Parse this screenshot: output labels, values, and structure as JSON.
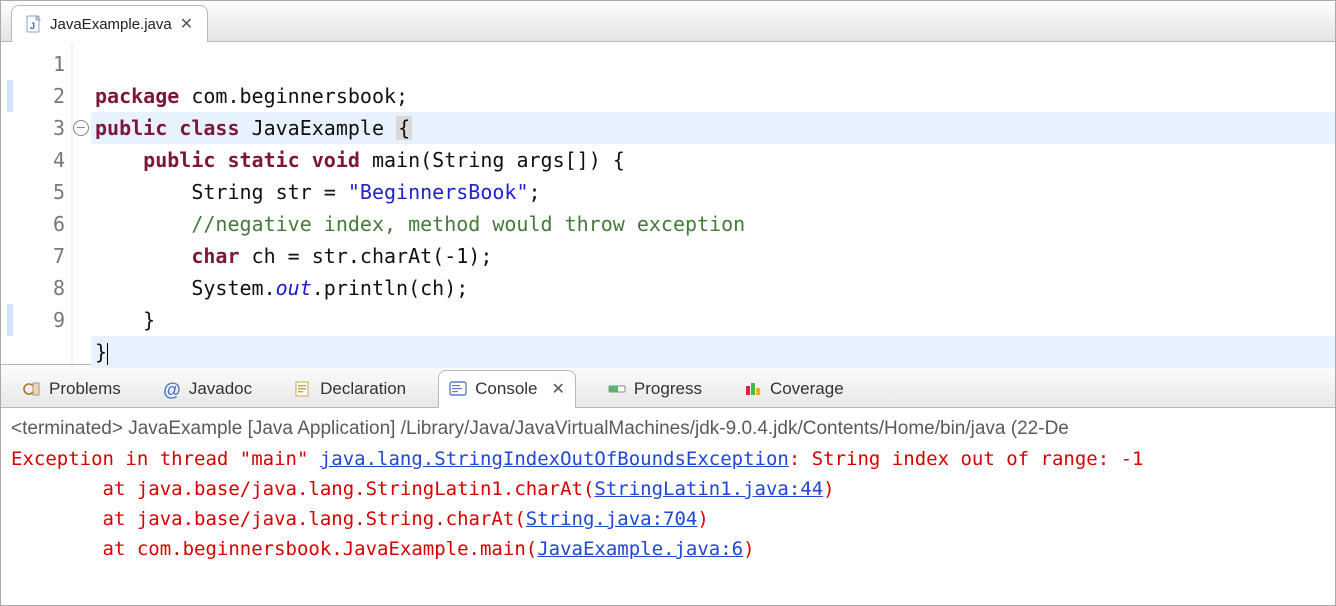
{
  "editor": {
    "tab_filename": "JavaExample.java",
    "lines": {
      "n1": "1",
      "n2": "2",
      "n3": "3",
      "n4": "4",
      "n5": "5",
      "n6": "6",
      "n7": "7",
      "n8": "8",
      "n9": "9"
    },
    "tokens": {
      "l1_kw1": "package",
      "l1_rest": " com.beginnersbook;",
      "l2_kw1": "public",
      "l2_kw2": "class",
      "l2_cls": "JavaExample",
      "l2_brace": "{",
      "l3_ind": "    ",
      "l3_kw1": "public",
      "l3_kw2": "static",
      "l3_kw3": "void",
      "l3_name": " main(String args[]) {",
      "l4_ind": "        ",
      "l4_t": "String str = ",
      "l4_s": "\"BeginnersBook\"",
      "l4_e": ";",
      "l5_ind": "        ",
      "l5_c": "//negative index, method would throw exception",
      "l6_ind": "        ",
      "l6_kw": "char",
      "l6_rest": " ch = str.charAt(-1);",
      "l7_ind": "        ",
      "l7_a": "System.",
      "l7_out": "out",
      "l7_b": ".println(ch);",
      "l8": "    }",
      "l9": "}"
    }
  },
  "panel_tabs": {
    "problems": "Problems",
    "javadoc": "Javadoc",
    "declaration": "Declaration",
    "console": "Console",
    "progress": "Progress",
    "coverage": "Coverage"
  },
  "console": {
    "terminated_line": "<terminated> JavaExample [Java Application] /Library/Java/JavaVirtualMachines/jdk-9.0.4.jdk/Contents/Home/bin/java (22-De",
    "l1_a": "Exception in thread \"main\" ",
    "l1_link": "java.lang.StringIndexOutOfBoundsException",
    "l1_b": ": String index out of range: -1",
    "l2_a": "        at java.base/java.lang.StringLatin1.charAt(",
    "l2_link": "StringLatin1.java:44",
    "l2_b": ")",
    "l3_a": "        at java.base/java.lang.String.charAt(",
    "l3_link": "String.java:704",
    "l3_b": ")",
    "l4_a": "        at com.beginnersbook.JavaExample.main(",
    "l4_link": "JavaExample.java:6",
    "l4_b": ")"
  }
}
